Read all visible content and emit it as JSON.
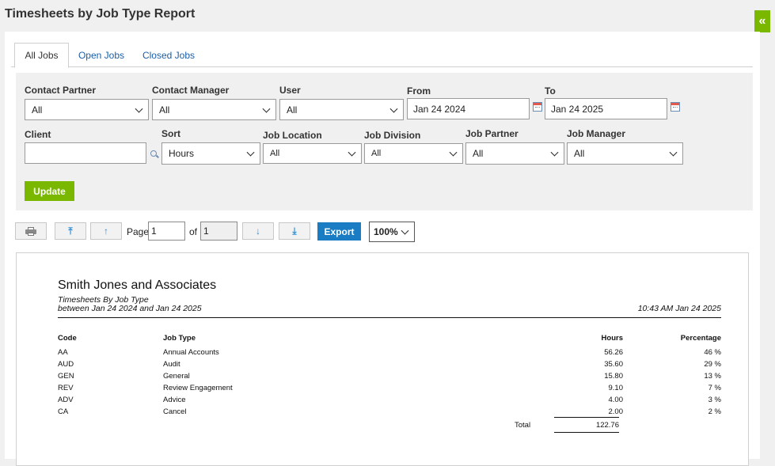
{
  "page": {
    "title": "Timesheets by Job Type Report"
  },
  "collapse_glyph": "«",
  "tabs": [
    {
      "label": "All Jobs",
      "active": true
    },
    {
      "label": "Open Jobs",
      "active": false
    },
    {
      "label": "Closed Jobs",
      "active": false
    }
  ],
  "filters": {
    "contact_partner": {
      "label": "Contact Partner",
      "value": "All"
    },
    "contact_manager": {
      "label": "Contact Manager",
      "value": "All"
    },
    "user": {
      "label": "User",
      "value": "All"
    },
    "from": {
      "label": "From",
      "value": "Jan 24 2024"
    },
    "to": {
      "label": "To",
      "value": "Jan 24 2025"
    },
    "client": {
      "label": "Client",
      "value": ""
    },
    "sort": {
      "label": "Sort",
      "value": "Hours"
    },
    "job_location": {
      "label": "Job Location",
      "value": "All"
    },
    "job_division": {
      "label": "Job Division",
      "value": "All"
    },
    "job_partner": {
      "label": "Job Partner",
      "value": "All"
    },
    "job_manager": {
      "label": "Job Manager",
      "value": "All"
    },
    "update_label": "Update"
  },
  "toolbar": {
    "first_glyph": "⤒",
    "prev_glyph": "↑",
    "next_glyph": "↓",
    "last_glyph": "⤓",
    "page_label": "Page",
    "page_value": "1",
    "of_label": "of",
    "total_pages": "1",
    "export_label": "Export",
    "zoom": "100%"
  },
  "report": {
    "company": "Smith Jones and Associates",
    "subtitle": "Timesheets By Job Type",
    "range": "between Jan 24 2024 and Jan 24 2025",
    "generated": "10:43 AM Jan 24 2025",
    "columns": {
      "code": "Code",
      "job_type": "Job Type",
      "hours": "Hours",
      "percentage": "Percentage"
    },
    "rows": [
      {
        "code": "AA",
        "job_type": "Annual Accounts",
        "hours": "56.26",
        "percentage": "46 %"
      },
      {
        "code": "AUD",
        "job_type": "Audit",
        "hours": "35.60",
        "percentage": "29 %"
      },
      {
        "code": "GEN",
        "job_type": "General",
        "hours": "15.80",
        "percentage": "13 %"
      },
      {
        "code": "REV",
        "job_type": "Review Engagement",
        "hours": "9.10",
        "percentage": "7 %"
      },
      {
        "code": "ADV",
        "job_type": "Advice",
        "hours": "4.00",
        "percentage": "3 %"
      },
      {
        "code": "CA",
        "job_type": "Cancel",
        "hours": "2.00",
        "percentage": "2 %"
      }
    ],
    "total_label": "Total",
    "total_hours": "122.76"
  },
  "icons": {
    "printer": "printer-icon",
    "calendar": "calendar-icon",
    "search": "search-icon",
    "collapse": "double-chevron-left-icon"
  },
  "colors": {
    "brand_green": "#7ab800",
    "export_blue": "#1a7dc4",
    "link_blue": "#1a5ea8"
  }
}
